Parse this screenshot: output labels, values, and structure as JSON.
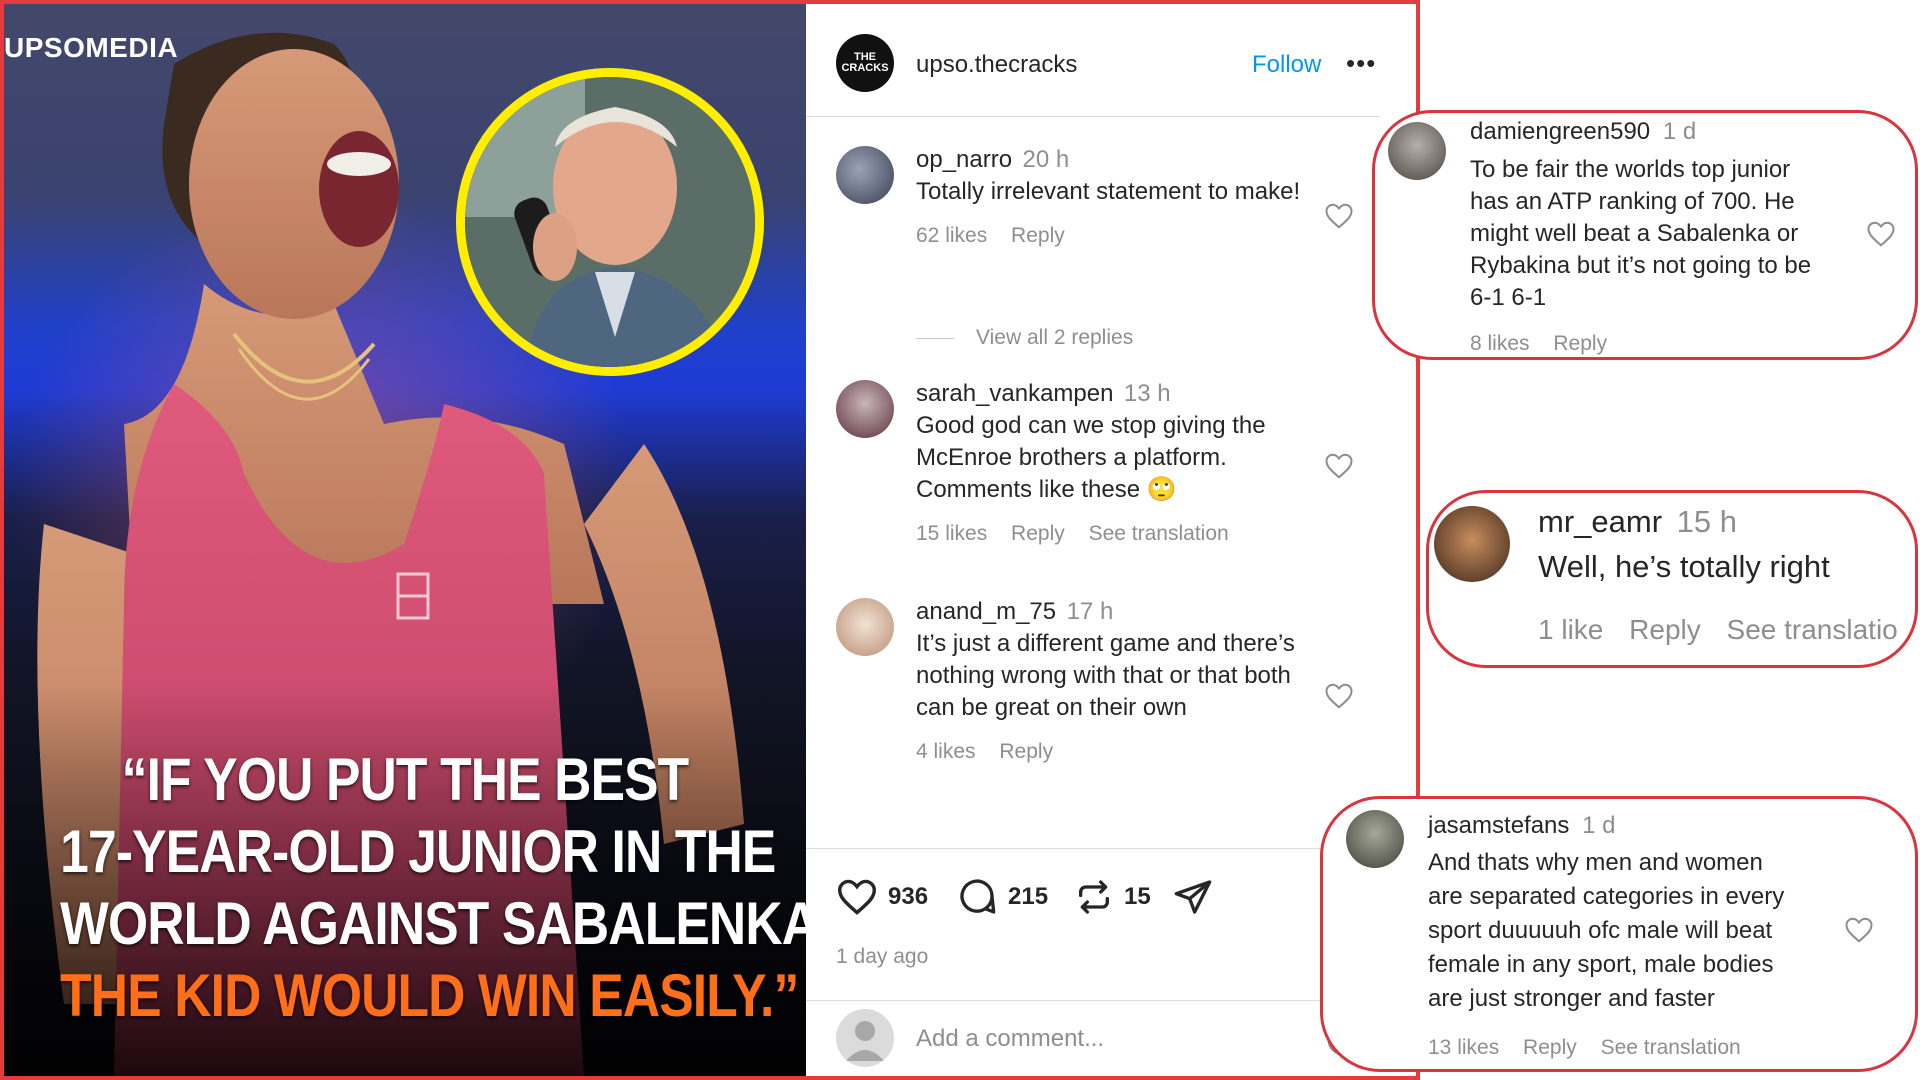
{
  "image": {
    "watermark": "UPSOMEDIA",
    "quote_lines": [
      "“IF YOU PUT THE BEST",
      "17-YEAR-OLD JUNIOR IN THE",
      "WORLD AGAINST SABALENKA,",
      "THE KID WOULD WIN EASILY.”"
    ],
    "colors": {
      "quote_white": "#ffffff",
      "quote_orange": "#ff6f1a",
      "circle_border": "#ffee00"
    }
  },
  "post": {
    "avatar_text_1": "THE",
    "avatar_text_2": "CRACKS",
    "username": "upso.thecracks",
    "follow_label": "Follow",
    "more_label": "•••",
    "comments": [
      {
        "user": "op_narro",
        "time": "20 h",
        "text": "Totally irrelevant statement to make!",
        "likes": "62 likes",
        "reply": "Reply",
        "translation": ""
      },
      {
        "user": "sarah_vankampen",
        "time": "13 h",
        "text": "Good god can we stop giving the McEnroe brothers a platform. Comments like these 🙄",
        "likes": "15 likes",
        "reply": "Reply",
        "translation": "See translation"
      },
      {
        "user": "anand_m_75",
        "time": "17 h",
        "text": "It’s just a different game and there’s nothing wrong with that or that both can be great on their own",
        "likes": "4 likes",
        "reply": "Reply",
        "translation": ""
      }
    ],
    "view_replies": "View all 2 replies",
    "like_count": "936",
    "comment_count": "215",
    "repost_count": "15",
    "date": "1 day ago",
    "input_placeholder": "Add a comment..."
  },
  "highlighted": [
    {
      "user": "damiengreen590",
      "time": "1 d",
      "text_lines": [
        "To be fair the worlds top junior",
        "has an ATP ranking of 700. He",
        "might well beat a Sabalenka or",
        "Rybakina but it’s not going to be",
        "6-1 6-1"
      ],
      "likes": "8 likes",
      "reply": "Reply"
    },
    {
      "user": "mr_eamr",
      "time": "15 h",
      "text_lines": [
        "Well, he’s totally right"
      ],
      "likes": "1 like",
      "reply": "Reply",
      "translation": "See translatio"
    },
    {
      "user": "jasamstefans",
      "time": "1 d",
      "text_lines": [
        "And thats why men and women",
        "are separated categories in every",
        "sport duuuuuh ofc male will beat",
        "female in any sport, male bodies",
        "are just stronger and faster"
      ],
      "likes": "13 likes",
      "reply": "Reply",
      "translation": "See translation"
    }
  ],
  "accent_colors": {
    "frame_red": "#e43c3c",
    "link_blue": "#0095f6",
    "muted_text": "#8e8e8e"
  }
}
